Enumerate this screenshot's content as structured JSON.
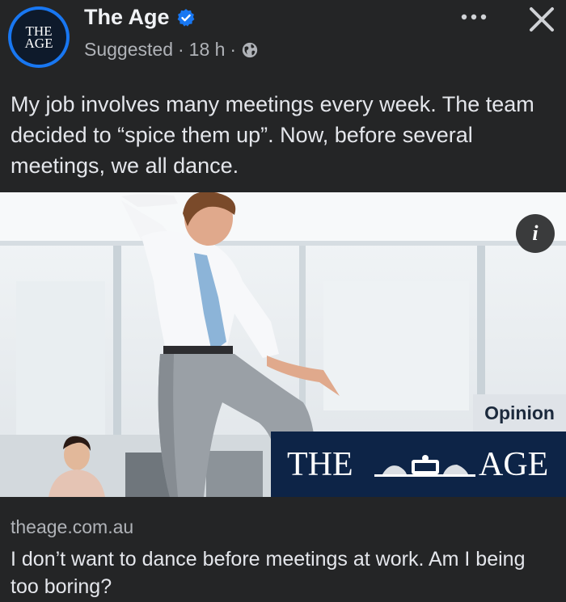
{
  "page": {
    "name": "The Age",
    "avatar_line1": "THE",
    "avatar_line2": "AGE",
    "suggested": "Suggested",
    "separator1": "·",
    "time": "18 h",
    "separator2": "·"
  },
  "post": {
    "caption": "My job involves many meetings every week. The team decided to “spice them up”. Now, before several meetings, we all dance."
  },
  "link": {
    "info_icon_glyph": "i",
    "opinion_label": "Opinion",
    "banner_left": "THE",
    "banner_right": "AGE",
    "domain": "theage.com.au",
    "headline": "I don’t want to dance before meetings at work. Am I being too boring?"
  },
  "icons": {
    "verified": "verified-badge-icon",
    "privacy": "globe-icon",
    "more": "more-options-icon",
    "close": "close-icon",
    "info": "info-icon"
  },
  "colors": {
    "background": "#242526",
    "accent": "#1877f2",
    "banner": "#0d2447"
  }
}
